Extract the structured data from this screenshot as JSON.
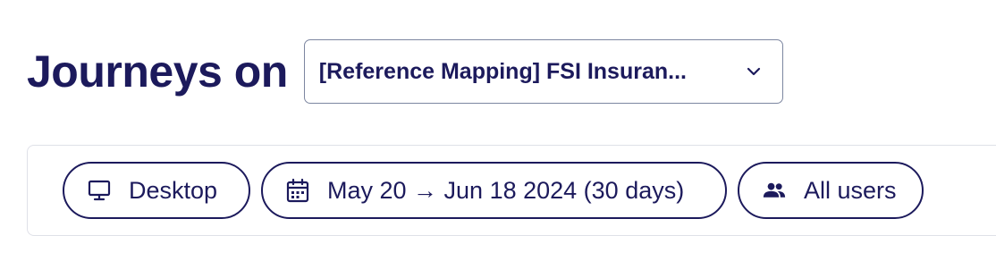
{
  "header": {
    "title": "Journeys on",
    "project_select": {
      "value": "[Reference Mapping] FSI Insuran...",
      "icon": "chevron-down-icon"
    }
  },
  "filters": {
    "device": {
      "label": "Desktop",
      "icon": "desktop-icon"
    },
    "date_range": {
      "label": "May 20 → Jun 18 2024 (30 days)",
      "icon": "calendar-icon"
    },
    "segment": {
      "label": "All users",
      "icon": "users-icon"
    }
  },
  "colors": {
    "primary_text": "#1c1a5c",
    "select_border": "#7c86a0",
    "panel_border": "#dfe1e8",
    "background": "#ffffff"
  }
}
